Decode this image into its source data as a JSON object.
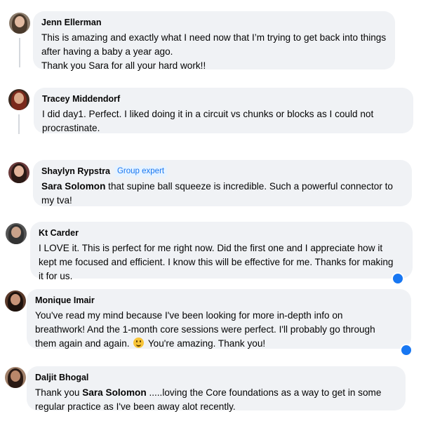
{
  "comments": [
    {
      "author": "Jenn Ellerman",
      "lines": [
        "This is amazing and exactly what I need now that I’m trying to get back into things",
        "after having a baby a year ago.",
        "Thank you Sara for all your hard work!!"
      ]
    },
    {
      "author": "Tracey Middendorf",
      "lines": [
        "I did day1. Perfect. I liked doing it in a circuit vs chunks or blocks as I could not",
        "procrastinate."
      ]
    },
    {
      "author": "Shaylyn Rypstra",
      "badge": "Group expert",
      "mention": "Sara Solomon",
      "line1_rest": " that supine ball squeeze is incredible. Such a powerful connector to",
      "line2": "my tva!"
    },
    {
      "author": "Kt Carder",
      "lines": [
        "I LOVE it. This is perfect for me right now. Did the first one and I appreciate how it",
        "kept me focused and efficient. I know this will be effective for me. Thanks for making",
        "it for us."
      ]
    },
    {
      "author": "Monique Imair",
      "lines": [
        "You've read my mind because I've been looking for more in-depth info on",
        "breathwork! And the 1-month core sessions were perfect. I'll probably go through"
      ],
      "line3_before_emoji": "them again and again.",
      "line3_after_emoji": "You're amazing. Thank you!",
      "emoji": "smiling-face"
    },
    {
      "author": "Daljit Bhogal",
      "line1_prefix": "Thank you ",
      "mention": "Sara Solomon",
      "line1_rest": " .....loving the Core foundations as a way to get in some",
      "line2": "regular practice as I've been away alot recently."
    }
  ],
  "colors": {
    "bubble": "#f0f2f5",
    "badge_bg": "#e7f3ff",
    "badge_text": "#1877f2",
    "thread_line": "#d5d8dd"
  }
}
